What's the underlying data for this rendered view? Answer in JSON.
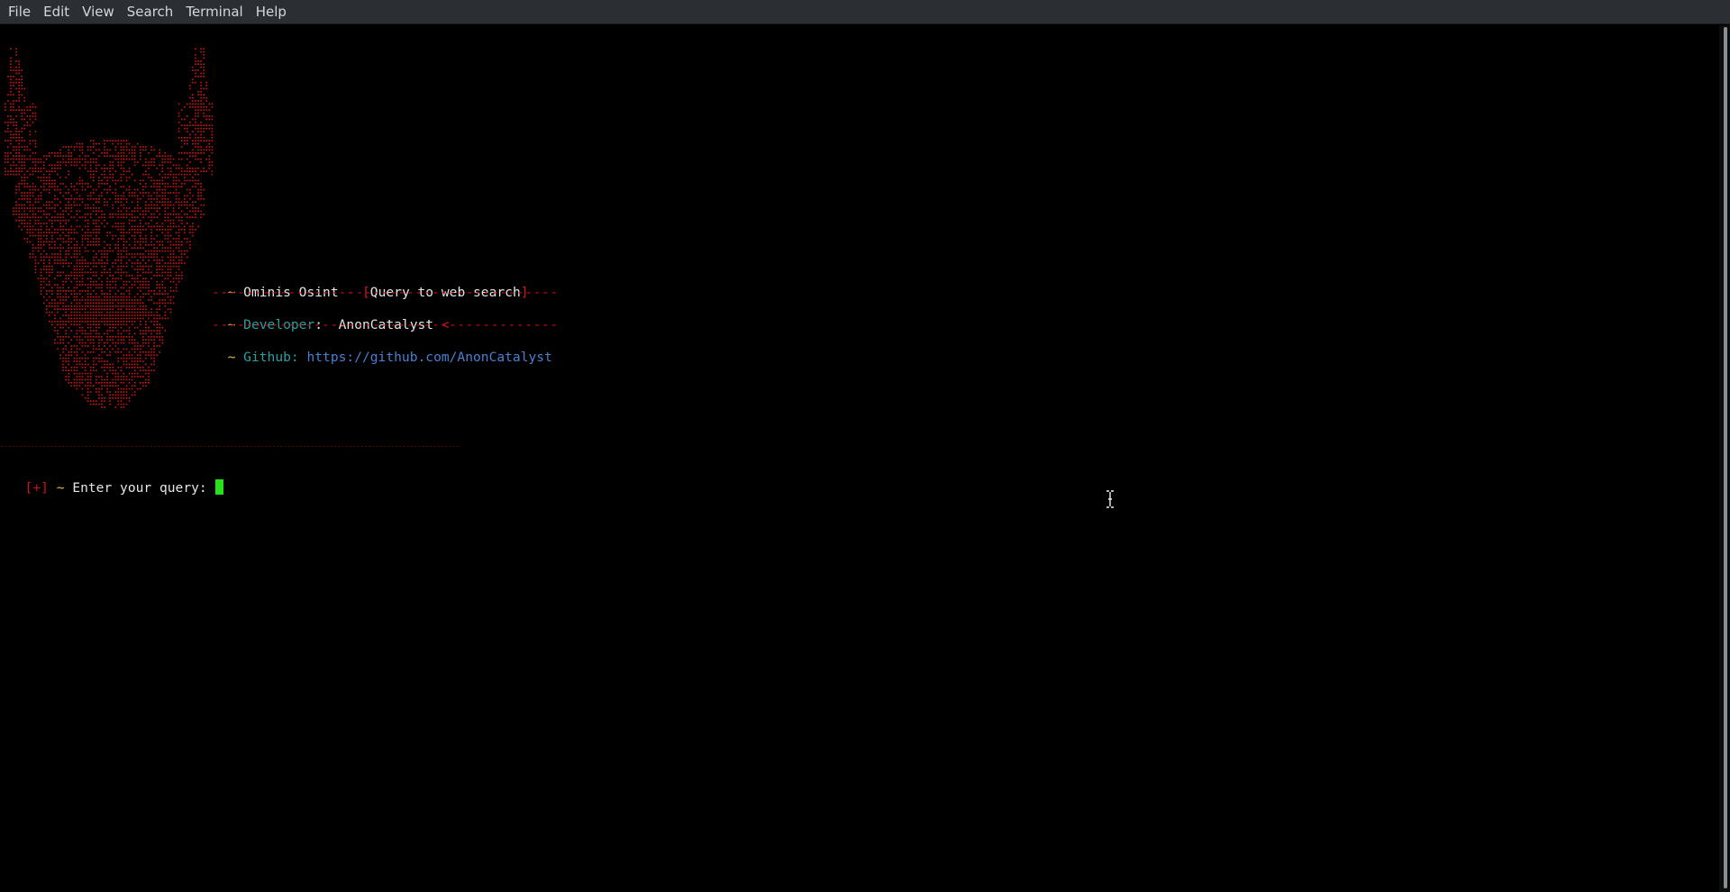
{
  "menubar": {
    "items": [
      "File",
      "Edit",
      "View",
      "Search",
      "Terminal",
      "Help"
    ]
  },
  "banner": {
    "title_prefix": "~",
    "title_name": "Ominis Osint",
    "title_sep": "-",
    "title_lbracket": "[",
    "title_desc": "Query to web search",
    "title_rbracket": "]",
    "divider": "-----------------------------------------",
    "dev_prefix": "~",
    "dev_label": "Developer",
    "dev_colon": ":",
    "dev_name": "AnonCatalyst",
    "dev_arrow": "<",
    "github_prefix": "~",
    "github_label": "Github:",
    "github_url": "https://github.com/AnonCatalyst"
  },
  "separator_line": "------------------------------------------------------------------------------------------------------------------------",
  "prompt": {
    "marker": "[+]",
    "tilde": "~",
    "text": "Enter your query:",
    "value": ""
  },
  "colors": {
    "menubar_bg": "#2b2e33",
    "terminal_bg": "#000000",
    "art_red": "#d01414",
    "cursor_green": "#25e21b",
    "link_blue": "#4a7fd4",
    "label_cyan": "#2aa1a1"
  },
  "icons": {
    "art": "demon-mask-ascii-art",
    "mouse": "text-ibeam-cursor-icon"
  }
}
